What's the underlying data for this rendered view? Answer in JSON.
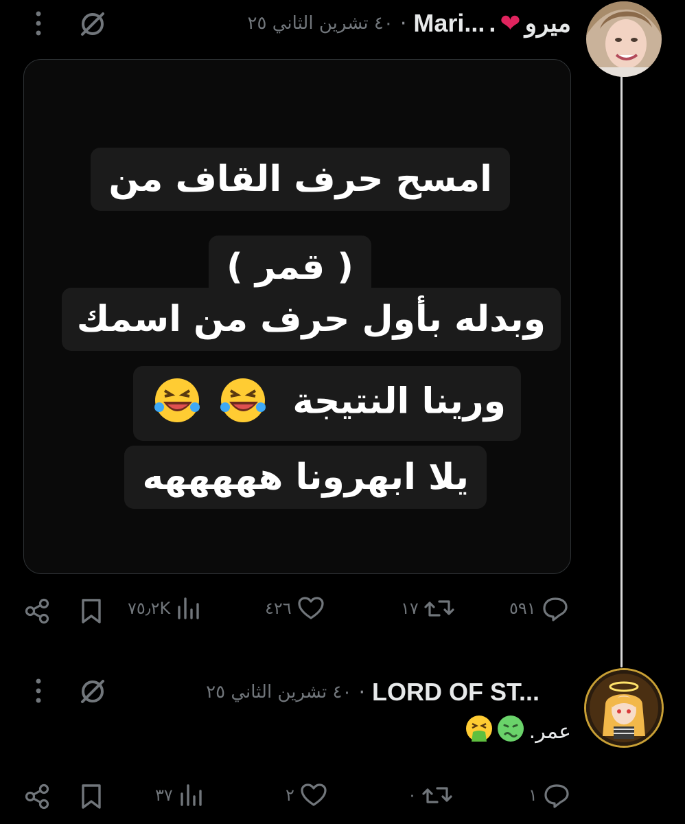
{
  "tweet1": {
    "author_ar": "ميرو",
    "author_en": "Mari...",
    "time": "٤٠ تشرين الثاني ٢٥",
    "meme": {
      "line1": "امسح حرف القاف من",
      "line2": "( قمر )",
      "line3": "وبدله بأول حرف من اسمك",
      "line4": "ورينا النتيجة",
      "line5": "يلا ابهرونا هههههه"
    },
    "actions": {
      "replies": "٥٩١",
      "reposts": "١٧",
      "likes": "٤٢٦",
      "views": "٧٥٫٢K"
    }
  },
  "tweet2": {
    "author": "LORD OF ST...",
    "time": "٤٠ تشرين الثاني ٢٥",
    "text": "عمر.",
    "actions": {
      "replies": "١",
      "reposts": "٠",
      "likes": "٢",
      "views": "٣٧"
    }
  },
  "icons": [
    "grok-icon",
    "more-icon",
    "reply-icon",
    "repost-icon",
    "like-icon",
    "views-icon",
    "bookmark-icon",
    "share-icon",
    "heart-emoji",
    "laughing-emoji",
    "sick-emoji",
    "vomit-emoji"
  ],
  "colors": {
    "background": "#000000",
    "text": "#e7e9ea",
    "muted": "#71767b",
    "heart": "#e0245e",
    "thread_line": "#d9d9d9"
  }
}
